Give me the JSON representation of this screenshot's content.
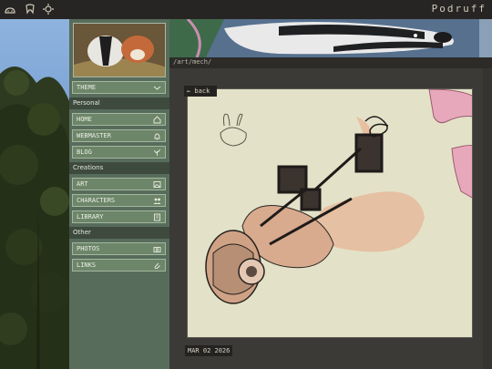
{
  "topbar": {
    "brand": "Podruff",
    "icons": [
      "bunny-icon",
      "tooth-icon",
      "sun-icon"
    ]
  },
  "sidebar": {
    "theme_label": "THEME",
    "sections": [
      {
        "title": "Personal",
        "items": [
          {
            "label": "HOME",
            "icon": "home-icon"
          },
          {
            "label": "WEBMASTER",
            "icon": "bell-icon"
          },
          {
            "label": "BLOG",
            "icon": "plant-icon"
          }
        ]
      },
      {
        "title": "Creations",
        "items": [
          {
            "label": "ART",
            "icon": "image-icon"
          },
          {
            "label": "CHARACTERS",
            "icon": "people-icon"
          },
          {
            "label": "LIBRARY",
            "icon": "book-icon"
          }
        ]
      },
      {
        "title": "Other",
        "items": [
          {
            "label": "PHOTOS",
            "icon": "camera-icon"
          },
          {
            "label": "LINKS",
            "icon": "paperclip-icon"
          }
        ]
      }
    ]
  },
  "header": {
    "path": "/art/mech/"
  },
  "viewer": {
    "back_label": "← back",
    "date": "MAR 02 2026"
  },
  "colors": {
    "sidebar_bg": "#586c5b",
    "button_bg": "#6d8569",
    "section_bg": "#3f4a3f",
    "canvas_bg": "#e3e2c8",
    "topbar_bg": "#272523"
  }
}
